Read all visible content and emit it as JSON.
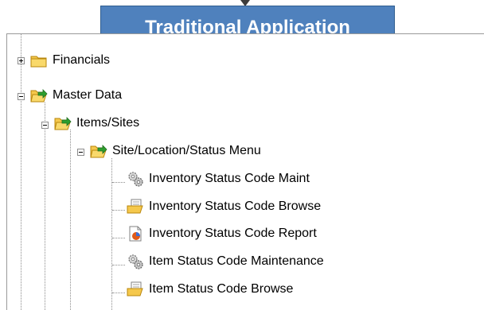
{
  "banner": {
    "title": "Traditional Application"
  },
  "tree": {
    "nodes": [
      {
        "label": "Financials",
        "icon": "folder-closed-icon",
        "expander": "plus"
      },
      {
        "label": "Master Data",
        "icon": "folder-open-arrow-icon",
        "expander": "minus"
      },
      {
        "label": "Items/Sites",
        "icon": "folder-open-arrow-icon",
        "expander": "minus"
      },
      {
        "label": "Site/Location/Status Menu",
        "icon": "folder-open-arrow-icon",
        "expander": "minus"
      },
      {
        "label": "Inventory Status Code Maint",
        "icon": "gears-icon"
      },
      {
        "label": "Inventory Status Code Browse",
        "icon": "browse-folder-icon"
      },
      {
        "label": "Inventory Status Code Report",
        "icon": "report-icon"
      },
      {
        "label": "Item Status Code Maintenance",
        "icon": "gears-icon"
      },
      {
        "label": "Item Status Code Browse",
        "icon": "browse-folder-icon"
      }
    ]
  },
  "colors": {
    "banner_bg": "#4f81bd",
    "folder": "#f5c84c",
    "arrow": "#2e9e2e"
  }
}
